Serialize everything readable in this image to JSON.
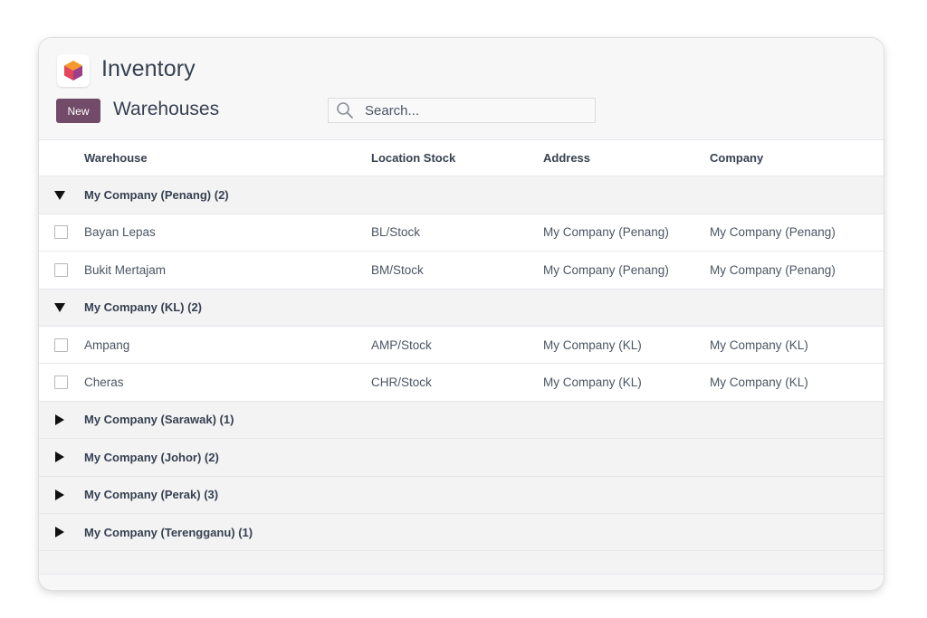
{
  "app": {
    "title": "Inventory"
  },
  "control_panel": {
    "new_label": "New",
    "page_title": "Warehouses",
    "search_placeholder": "Search..."
  },
  "table": {
    "columns": [
      "Warehouse",
      "Location Stock",
      "Address",
      "Company"
    ],
    "rows": [
      {
        "kind": "group",
        "label": "My Company (Penang) (2)",
        "expanded": true
      },
      {
        "kind": "record",
        "warehouse": "Bayan Lepas",
        "location": "BL/Stock",
        "address": "My Company (Penang)",
        "company": "My Company (Penang)"
      },
      {
        "kind": "record",
        "warehouse": "Bukit Mertajam",
        "location": "BM/Stock",
        "address": "My Company (Penang)",
        "company": "My Company (Penang)"
      },
      {
        "kind": "group",
        "label": "My Company (KL) (2)",
        "expanded": true
      },
      {
        "kind": "record",
        "warehouse": "Ampang",
        "location": "AMP/Stock",
        "address": "My Company (KL)",
        "company": "My Company (KL)"
      },
      {
        "kind": "record",
        "warehouse": "Cheras",
        "location": "CHR/Stock",
        "address": "My Company (KL)",
        "company": "My Company (KL)"
      },
      {
        "kind": "group",
        "label": "My Company (Sarawak) (1)",
        "expanded": false
      },
      {
        "kind": "group",
        "label": "My Company (Johor) (2)",
        "expanded": false
      },
      {
        "kind": "group",
        "label": "My Company (Perak) (3)",
        "expanded": false
      },
      {
        "kind": "group",
        "label": "My Company (Terengganu) (1)",
        "expanded": false
      }
    ]
  },
  "icons": {
    "app_logo": "inventory-hexagon-icon",
    "search": "search-icon",
    "expanded": "caret-down-icon",
    "collapsed": "caret-right-icon"
  },
  "colors": {
    "brand": "#714b67",
    "logo_top": "#f28c28",
    "logo_left": "#e0405b",
    "logo_right": "#8a3f8e"
  }
}
